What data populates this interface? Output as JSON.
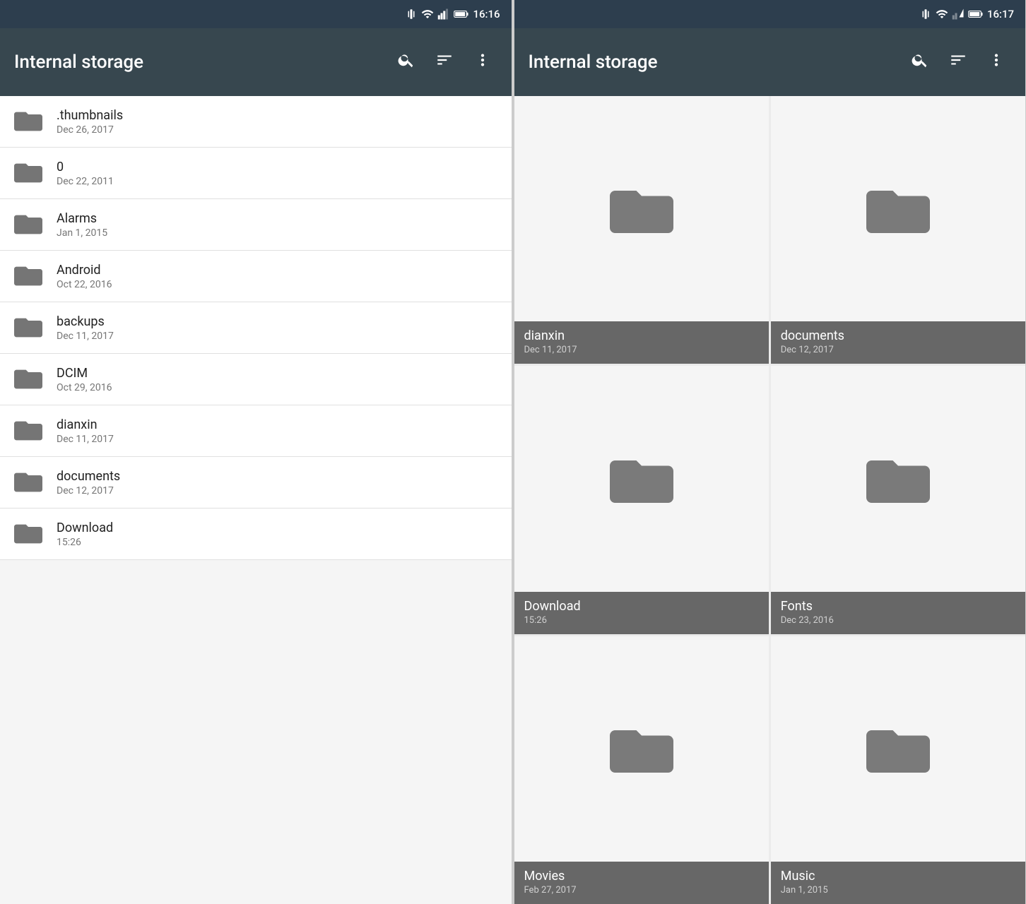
{
  "left_panel": {
    "status_bar": {
      "time": "16:16"
    },
    "toolbar": {
      "title": "Internal storage",
      "search_label": "search",
      "sort_label": "sort",
      "more_label": "more"
    },
    "items": [
      {
        "name": ".thumbnails",
        "date": "Dec 26, 2017"
      },
      {
        "name": "0",
        "date": "Dec 22, 2011"
      },
      {
        "name": "Alarms",
        "date": "Jan 1, 2015"
      },
      {
        "name": "Android",
        "date": "Oct 22, 2016"
      },
      {
        "name": "backups",
        "date": "Dec 11, 2017"
      },
      {
        "name": "DCIM",
        "date": "Oct 29, 2016"
      },
      {
        "name": "dianxin",
        "date": "Dec 11, 2017"
      },
      {
        "name": "documents",
        "date": "Dec 12, 2017"
      },
      {
        "name": "Download",
        "date": "15:26"
      }
    ]
  },
  "right_panel": {
    "status_bar": {
      "time": "16:17"
    },
    "toolbar": {
      "title": "Internal storage",
      "search_label": "search",
      "sort_label": "sort",
      "more_label": "more"
    },
    "items": [
      {
        "name": "dianxin",
        "date": "Dec 11, 2017"
      },
      {
        "name": "documents",
        "date": "Dec 12, 2017"
      },
      {
        "name": "Download",
        "date": "15:26"
      },
      {
        "name": "Fonts",
        "date": "Dec 23, 2016"
      },
      {
        "name": "Movies",
        "date": "Feb 27, 2017"
      },
      {
        "name": "Music",
        "date": "Jan 1, 2015"
      }
    ]
  },
  "icons": {
    "folder": "folder",
    "search": "🔍",
    "sort": "≡",
    "more": "⋮"
  }
}
